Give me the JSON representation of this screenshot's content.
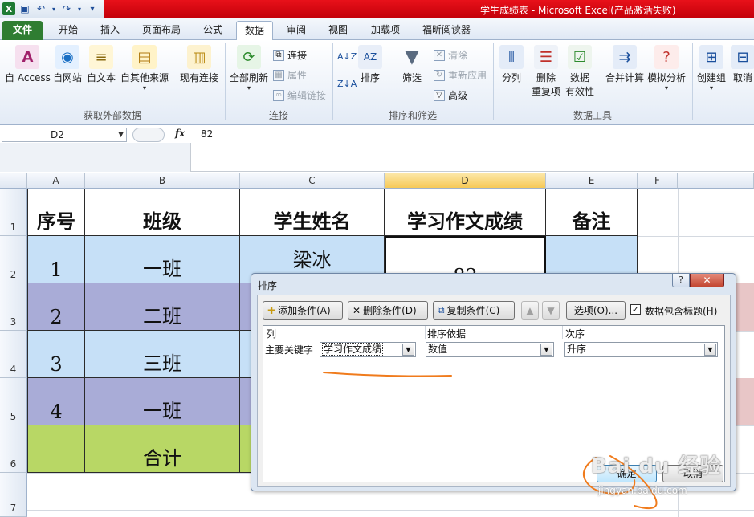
{
  "window": {
    "title": "学生成绩表 - Microsoft Excel(产品激活失败)",
    "qat_icons": [
      "excel-logo",
      "save-icon",
      "undo-icon",
      "redo-icon",
      "customize-icon"
    ]
  },
  "tabs": [
    {
      "label": "文件"
    },
    {
      "label": "开始"
    },
    {
      "label": "插入"
    },
    {
      "label": "页面布局"
    },
    {
      "label": "公式"
    },
    {
      "label": "数据"
    },
    {
      "label": "审阅"
    },
    {
      "label": "视图"
    },
    {
      "label": "加载项"
    },
    {
      "label": "福昕阅读器"
    }
  ],
  "ribbon": {
    "get_external": {
      "label": "获取外部数据",
      "access": "自 Access",
      "web": "自网站",
      "text": "自文本",
      "other": "自其他来源",
      "existing": "现有连接"
    },
    "connections": {
      "label": "连接",
      "refresh_all": "全部刷新",
      "connections": "连接",
      "properties": "属性",
      "edit_links": "编辑链接"
    },
    "sort_filter": {
      "label": "排序和筛选",
      "sort": "排序",
      "filter": "筛选",
      "clear": "清除",
      "reapply": "重新应用",
      "advanced": "高级"
    },
    "data_tools": {
      "label": "数据工具",
      "text_to_columns": "分列",
      "remove_dup_1": "删除",
      "remove_dup_2": "重复项",
      "validation_1": "数据",
      "validation_2": "有效性",
      "consolidate": "合并计算",
      "what_if": "模拟分析"
    },
    "outline": {
      "group": "创建组",
      "ungroup": "取消"
    }
  },
  "formula_bar": {
    "name_box": "D2",
    "fx": "fx",
    "value": "82"
  },
  "sheet": {
    "columns": [
      "A",
      "B",
      "C",
      "D",
      "E",
      "F"
    ],
    "rows": [
      "1",
      "2",
      "3",
      "4",
      "5",
      "6",
      "7"
    ],
    "header": [
      "序号",
      "班级",
      "学生姓名",
      "学习作文成绩",
      "备注"
    ],
    "data": [
      [
        "1",
        "一班",
        "梁冰",
        "82"
      ],
      [
        "2",
        "二班"
      ],
      [
        "3",
        "三班"
      ],
      [
        "4",
        "一班"
      ],
      [
        "",
        "合计"
      ]
    ]
  },
  "sort_dialog": {
    "title": "排序",
    "help": "?",
    "close": "✕",
    "add_level": "添加条件(A)",
    "delete_level": "删除条件(D)",
    "copy_level": "复制条件(C)",
    "options": "选项(O)...",
    "has_headers": "数据包含标题(H)",
    "has_headers_checked": true,
    "col_header": "列",
    "sort_on_header": "排序依据",
    "order_header": "次序",
    "row_label": "主要关键字",
    "column_value": "学习作文成绩",
    "sort_on_value": "数值",
    "order_value": "升序",
    "ok": "确定",
    "cancel": "取消"
  },
  "watermark": {
    "main": "Bai du 经验",
    "url": "jingyan.baidu.com"
  },
  "colors": {
    "title_red": "#d40b12",
    "file_tab_green": "#2f7d32",
    "row_blue": "#c6e0f7",
    "row_purple": "#a9acd7",
    "row_green": "#b8d765",
    "annotation_orange": "#f07b1c"
  }
}
